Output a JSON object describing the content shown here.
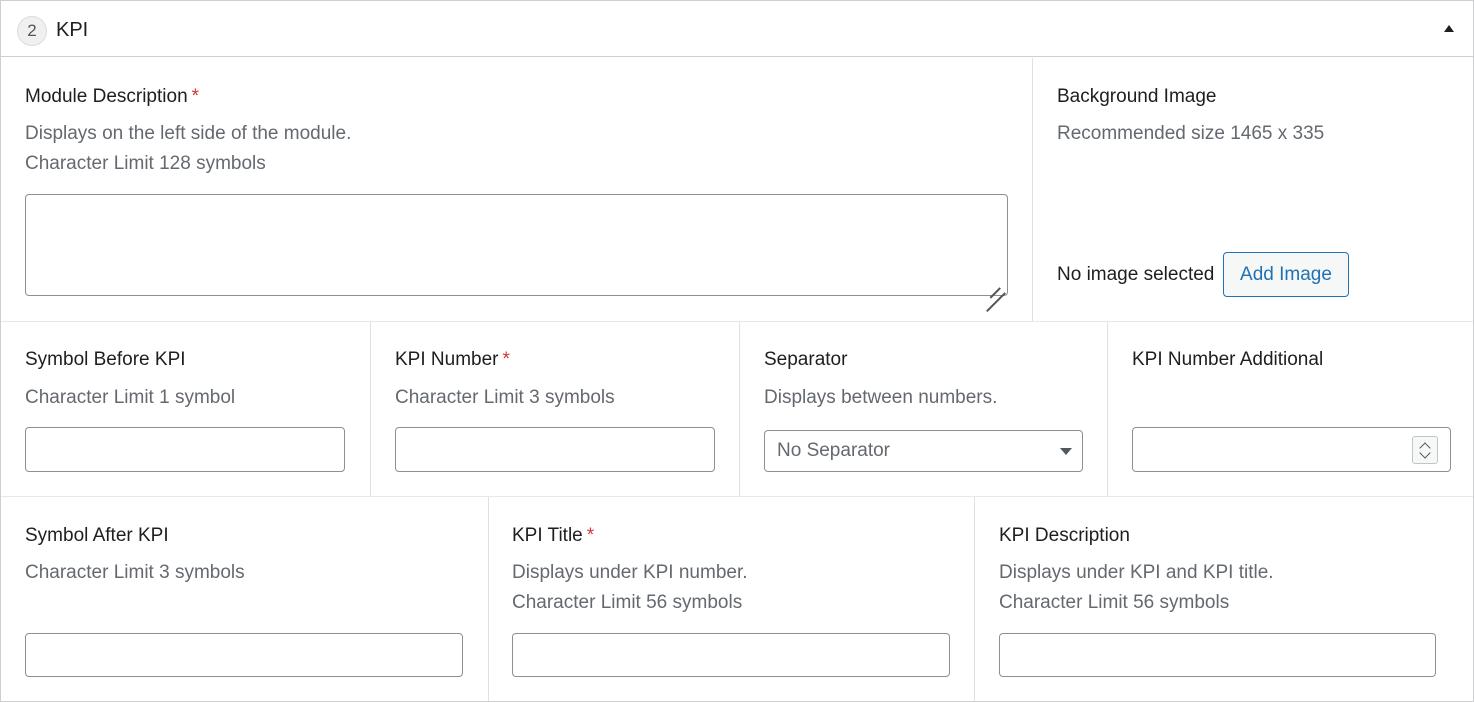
{
  "section": {
    "number": "2",
    "title": "KPI"
  },
  "module_description": {
    "label": "Module Description",
    "required": "*",
    "desc_line1": "Displays on the left side of the module.",
    "desc_line2": "Character Limit 128 symbols",
    "value": ""
  },
  "background_image": {
    "label": "Background Image",
    "desc": "Recommended size 1465 x 335",
    "status": "No image selected",
    "button": "Add Image"
  },
  "symbol_before": {
    "label": "Symbol Before KPI",
    "desc": "Character Limit 1 symbol",
    "value": ""
  },
  "kpi_number": {
    "label": "KPI Number",
    "required": "*",
    "desc": "Character Limit 3 symbols",
    "value": ""
  },
  "separator": {
    "label": "Separator",
    "desc": "Displays between numbers.",
    "selected": "No Separator"
  },
  "kpi_number_additional": {
    "label": "KPI Number Additional",
    "value": ""
  },
  "symbol_after": {
    "label": "Symbol After KPI",
    "desc": "Character Limit 3 symbols",
    "value": ""
  },
  "kpi_title": {
    "label": "KPI Title",
    "required": "*",
    "desc_line1": "Displays under KPI number.",
    "desc_line2": "Character Limit 56 symbols",
    "value": ""
  },
  "kpi_description": {
    "label": "KPI Description",
    "desc_line1": "Displays under KPI and KPI title.",
    "desc_line2": "Character Limit 56 symbols",
    "value": ""
  }
}
